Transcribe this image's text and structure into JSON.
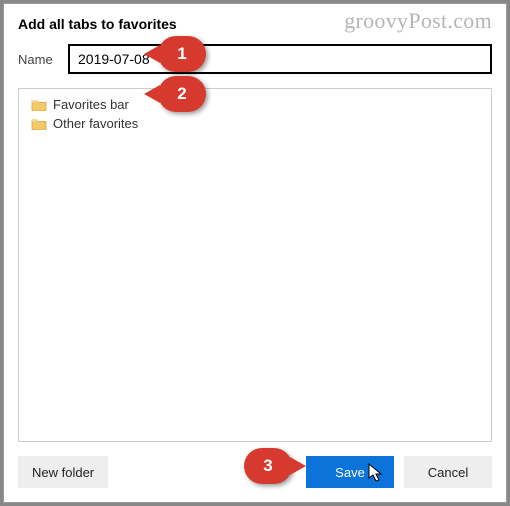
{
  "watermark": "groovyPost.com",
  "dialog": {
    "title": "Add all tabs to favorites",
    "name_label": "Name",
    "name_value": "2019-07-08"
  },
  "tree": {
    "items": [
      {
        "label": "Favorites bar"
      },
      {
        "label": "Other favorites"
      }
    ]
  },
  "buttons": {
    "new_folder": "New folder",
    "save": "Save",
    "cancel": "Cancel"
  },
  "callouts": {
    "one": "1",
    "two": "2",
    "three": "3"
  }
}
